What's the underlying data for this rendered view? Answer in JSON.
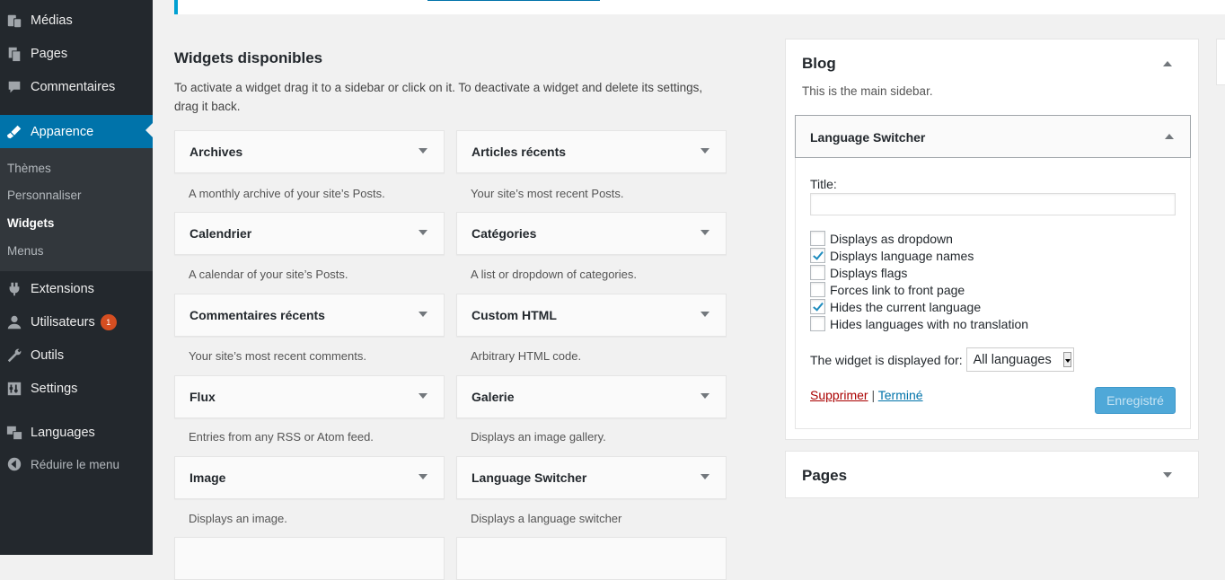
{
  "menu": {
    "items": [
      {
        "label": "Médias",
        "icon": "media-icon"
      },
      {
        "label": "Pages",
        "icon": "pages-icon"
      },
      {
        "label": "Commentaires",
        "icon": "comments-icon"
      },
      {
        "label": "Apparence",
        "icon": "appearance-icon"
      },
      {
        "label": "Extensions",
        "icon": "plugins-icon"
      },
      {
        "label": "Utilisateurs",
        "icon": "users-icon",
        "badge": "1"
      },
      {
        "label": "Outils",
        "icon": "tools-icon"
      },
      {
        "label": "Settings",
        "icon": "settings-icon"
      },
      {
        "label": "Languages",
        "icon": "languages-icon"
      }
    ],
    "submenu": [
      "Thèmes",
      "Personnaliser",
      "Widgets",
      "Menus"
    ],
    "collapse_label": "Réduire le menu"
  },
  "available": {
    "title": "Widgets disponibles",
    "description": "To activate a widget drag it to a sidebar or click on it. To deactivate a widget and delete its settings, drag it back.",
    "widgets": [
      {
        "title": "Archives",
        "desc": "A monthly archive of your site’s Posts."
      },
      {
        "title": "Articles récents",
        "desc": "Your site’s most recent Posts."
      },
      {
        "title": "Calendrier",
        "desc": "A calendar of your site’s Posts."
      },
      {
        "title": "Catégories",
        "desc": "A list or dropdown of categories."
      },
      {
        "title": "Commentaires récents",
        "desc": "Your site’s most recent comments."
      },
      {
        "title": "Custom HTML",
        "desc": "Arbitrary HTML code."
      },
      {
        "title": "Flux",
        "desc": "Entries from any RSS or Atom feed."
      },
      {
        "title": "Galerie",
        "desc": "Displays an image gallery."
      },
      {
        "title": "Image",
        "desc": "Displays an image."
      },
      {
        "title": "Language Switcher",
        "desc": "Displays a language switcher"
      }
    ]
  },
  "sidebar": {
    "title": "Blog",
    "description": "This is the main sidebar.",
    "widget": {
      "title": "Language Switcher",
      "field_label": "Title:",
      "field_value": "",
      "options": [
        {
          "label": "Displays as dropdown",
          "checked": false
        },
        {
          "label": "Displays language names",
          "checked": true
        },
        {
          "label": "Displays flags",
          "checked": false
        },
        {
          "label": "Forces link to front page",
          "checked": false
        },
        {
          "label": "Hides the current language",
          "checked": true
        },
        {
          "label": "Hides languages with no translation",
          "checked": false
        }
      ],
      "display_label": "The widget is displayed for:",
      "display_value": "All languages",
      "delete_label": "Supprimer",
      "separator": "|",
      "done_label": "Terminé",
      "save_label": "Enregistré"
    }
  },
  "pages_panel": {
    "title": "Pages"
  },
  "colors": {
    "accent": "#0073aa",
    "sidebar_bg": "#23282d",
    "badge": "#d54e21"
  }
}
